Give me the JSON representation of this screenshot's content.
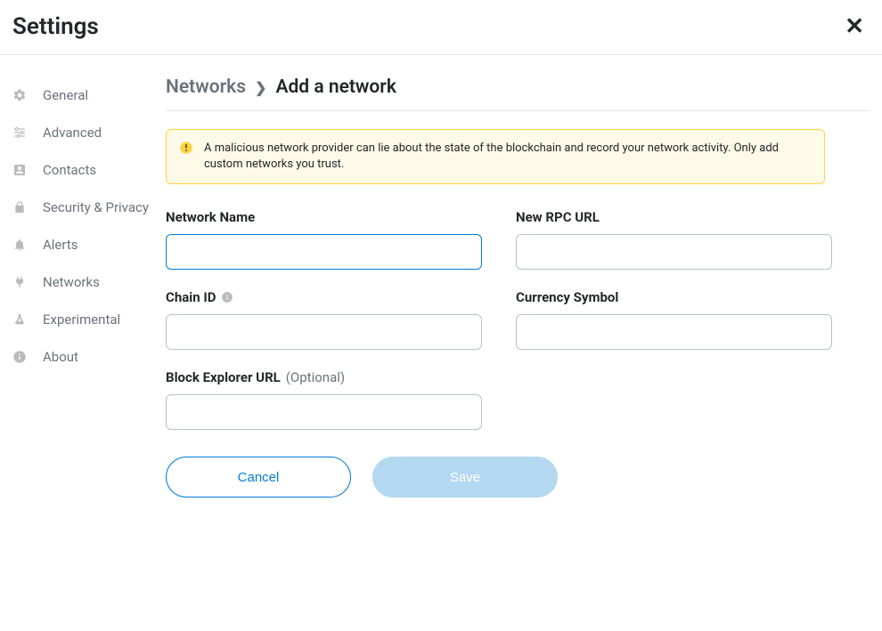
{
  "header": {
    "title": "Settings"
  },
  "sidebar": {
    "items": [
      {
        "label": "General"
      },
      {
        "label": "Advanced"
      },
      {
        "label": "Contacts"
      },
      {
        "label": "Security & Privacy"
      },
      {
        "label": "Alerts"
      },
      {
        "label": "Networks"
      },
      {
        "label": "Experimental"
      },
      {
        "label": "About"
      }
    ]
  },
  "breadcrumb": {
    "root": "Networks",
    "current": "Add a network"
  },
  "warning": {
    "text": "A malicious network provider can lie about the state of the blockchain and record your network activity. Only add custom networks you trust."
  },
  "form": {
    "network_name": {
      "label": "Network Name",
      "value": ""
    },
    "rpc_url": {
      "label": "New RPC URL",
      "value": ""
    },
    "chain_id": {
      "label": "Chain ID",
      "value": ""
    },
    "currency_symbol": {
      "label": "Currency Symbol",
      "value": ""
    },
    "block_explorer": {
      "label": "Block Explorer URL",
      "optional": "(Optional)",
      "value": ""
    }
  },
  "actions": {
    "cancel": "Cancel",
    "save": "Save"
  }
}
